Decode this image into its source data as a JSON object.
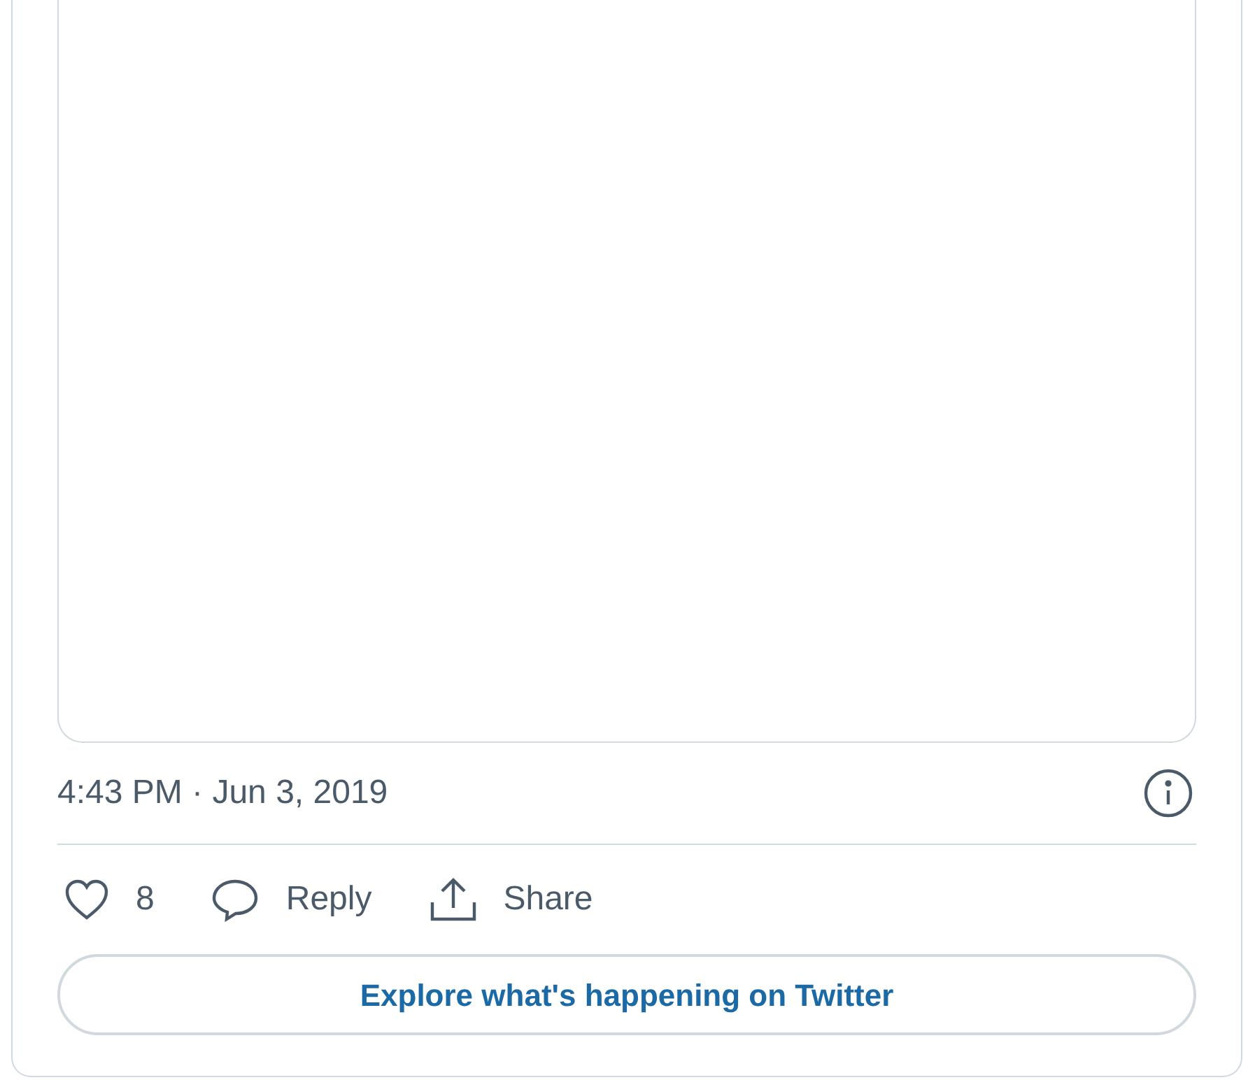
{
  "tweet": {
    "timestamp": "4:43 PM · Jun 3, 2019",
    "actions": [
      {
        "kind": "like",
        "label": "8"
      },
      {
        "kind": "reply",
        "label": "Reply"
      },
      {
        "kind": "share",
        "label": "Share"
      }
    ],
    "explore_button": "Explore what's happening on Twitter"
  }
}
